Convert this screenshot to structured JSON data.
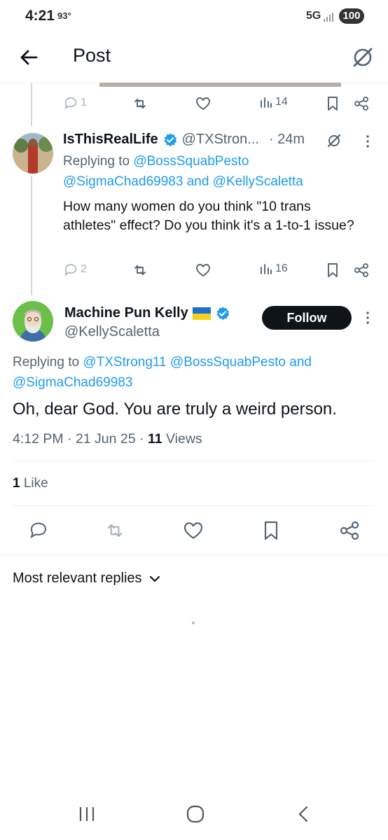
{
  "status": {
    "time": "4:21",
    "temp": "93°",
    "network": "5G",
    "battery": "100"
  },
  "header": {
    "title": "Post"
  },
  "prev_tweet_actions": {
    "replies": "1",
    "views": "14"
  },
  "reply_tweet": {
    "name": "IsThisRealLife",
    "handle": "@TXStron...",
    "time": "· 24m",
    "replying_label": "Replying to",
    "mention_1": "@BossSquabPesto",
    "mention_2": "@SigmaChad69983",
    "and_label": "and",
    "mention_3": "@KellyScaletta",
    "text": "How many women do you think \"10 trans athletes\" effect? Do you think it's a 1-to-1 issue?",
    "replies": "2",
    "views": "16"
  },
  "main_tweet": {
    "name": "Machine Pun Kelly",
    "handle": "@KellyScaletta",
    "follow_label": "Follow",
    "replying_label": "Replying to",
    "mention_1": "@TXStrong11",
    "mention_2": "@BossSquabPesto",
    "and_label": "and",
    "mention_3": "@SigmaChad69983",
    "text": "Oh, dear God. You are truly a weird person.",
    "time": "4:12 PM · 21 Jun 25 ·",
    "views_count": "11",
    "views_label": "Views",
    "likes_count": "1",
    "likes_label": "Like"
  },
  "replies_sort": {
    "label": "Most relevant replies"
  },
  "colors": {
    "link": "#1d9bf0",
    "verified": "#1d9bf0",
    "muted": "#536471",
    "text": "#0f1419"
  },
  "icons": [
    "back-arrow-icon",
    "grok-icon",
    "reply-icon",
    "retweet-icon",
    "like-icon",
    "views-icon",
    "bookmark-icon",
    "share-icon",
    "verified-icon",
    "ukraine-flag-icon",
    "chevron-down-icon"
  ]
}
